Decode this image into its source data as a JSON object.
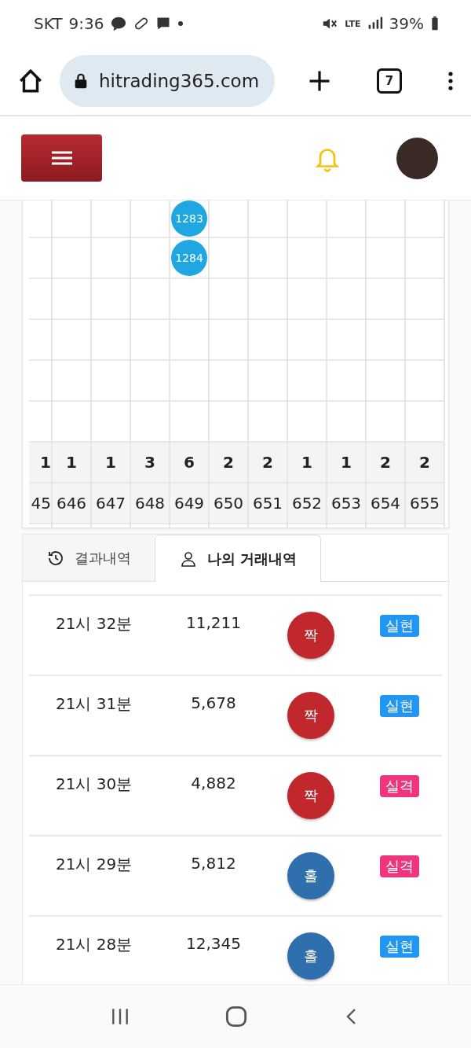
{
  "status_bar": {
    "carrier": "SKT",
    "time": "9:36",
    "network": "LTE",
    "battery": "39%"
  },
  "browser": {
    "url": "hitrading365.com",
    "tab_count": "7"
  },
  "grid": {
    "columns": [
      {
        "count": "1",
        "number": "45"
      },
      {
        "count": "1",
        "number": "646"
      },
      {
        "count": "1",
        "number": "647"
      },
      {
        "count": "3",
        "number": "648"
      },
      {
        "count": "6",
        "number": "649",
        "markers": [
          "1283",
          "1284"
        ]
      },
      {
        "count": "2",
        "number": "650"
      },
      {
        "count": "2",
        "number": "651"
      },
      {
        "count": "1",
        "number": "652"
      },
      {
        "count": "1",
        "number": "653"
      },
      {
        "count": "2",
        "number": "654"
      },
      {
        "count": "2",
        "number": "655"
      }
    ]
  },
  "tabs": [
    {
      "label": "결과내역",
      "kind": "history",
      "selected": false
    },
    {
      "label": "나의 거래내역",
      "kind": "person",
      "selected": true
    }
  ],
  "rows": [
    {
      "time": "21시 32분",
      "amount": "11,211",
      "pick": {
        "label": "짝",
        "color": "#c0282d"
      },
      "result": {
        "label": "실현",
        "color": "#2196f3"
      }
    },
    {
      "time": "21시 31분",
      "amount": "5,678",
      "pick": {
        "label": "짝",
        "color": "#c0282d"
      },
      "result": {
        "label": "실현",
        "color": "#2196f3"
      }
    },
    {
      "time": "21시 30분",
      "amount": "4,882",
      "pick": {
        "label": "짝",
        "color": "#c0282d"
      },
      "result": {
        "label": "실격",
        "color": "#f0357f"
      }
    },
    {
      "time": "21시 29분",
      "amount": "5,812",
      "pick": {
        "label": "홀",
        "color": "#2f6fad"
      },
      "result": {
        "label": "실격",
        "color": "#f0357f"
      }
    },
    {
      "time": "21시 28분",
      "amount": "12,345",
      "pick": {
        "label": "홀",
        "color": "#2f6fad"
      },
      "result": {
        "label": "실현",
        "color": "#2196f3"
      }
    }
  ]
}
